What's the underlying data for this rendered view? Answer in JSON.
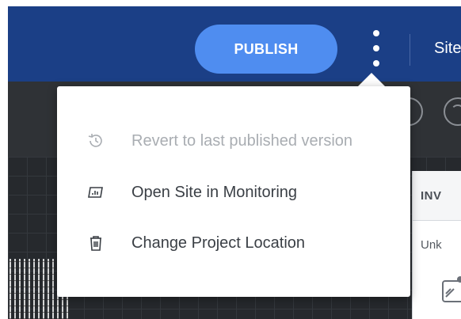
{
  "topbar": {
    "publish_label": "PUBLISH",
    "site_label": "Site"
  },
  "menu": {
    "items": [
      {
        "label": "Revert to last published version",
        "icon": "history-icon",
        "disabled": true
      },
      {
        "label": "Open Site in Monitoring",
        "icon": "monitoring-chart-icon",
        "disabled": false
      },
      {
        "label": "Change Project Location",
        "icon": "trash-icon",
        "disabled": false
      }
    ]
  },
  "side_panel": {
    "header": "INV",
    "sub_label": "Unk"
  },
  "colors": {
    "topbar": "#1b3f86",
    "publish_button": "#4f8df0",
    "workspace": "#25282c",
    "menu_text": "#3a3f45",
    "menu_text_disabled": "#a9adb2"
  }
}
